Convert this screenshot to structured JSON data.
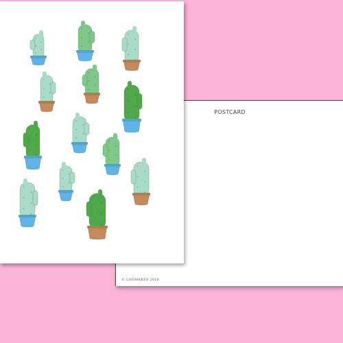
{
  "colors": {
    "background": "#fbb3d8",
    "card": "#ffffff",
    "pot_blue": "#5fb3e6",
    "pot_terracotta": "#c48a5a",
    "cactus_light": "#a8dcc8",
    "cactus_mid": "#7ec98a",
    "cactus_dark": "#4fa84a"
  },
  "back": {
    "title": "POSTCARD",
    "copyright": "© LOOMAKES 2018"
  },
  "front": {
    "plants": [
      {
        "icon": "potted-cactus-icon",
        "variant": "light"
      },
      {
        "icon": "potted-cactus-icon",
        "variant": "mid"
      },
      {
        "icon": "potted-cactus-icon",
        "variant": "light"
      },
      {
        "icon": "potted-cactus-icon",
        "variant": "light"
      },
      {
        "icon": "potted-cactus-icon",
        "variant": "mid"
      },
      {
        "icon": "potted-cactus-icon",
        "variant": "dark"
      },
      {
        "icon": "potted-cactus-icon",
        "variant": "dark"
      },
      {
        "icon": "potted-cactus-icon",
        "variant": "light"
      },
      {
        "icon": "potted-cactus-icon",
        "variant": "mid"
      },
      {
        "icon": "potted-cactus-icon",
        "variant": "light"
      },
      {
        "icon": "potted-cactus-icon",
        "variant": "light"
      },
      {
        "icon": "potted-cactus-icon",
        "variant": "light"
      },
      {
        "icon": "potted-cactus-icon",
        "variant": "dark"
      }
    ]
  }
}
